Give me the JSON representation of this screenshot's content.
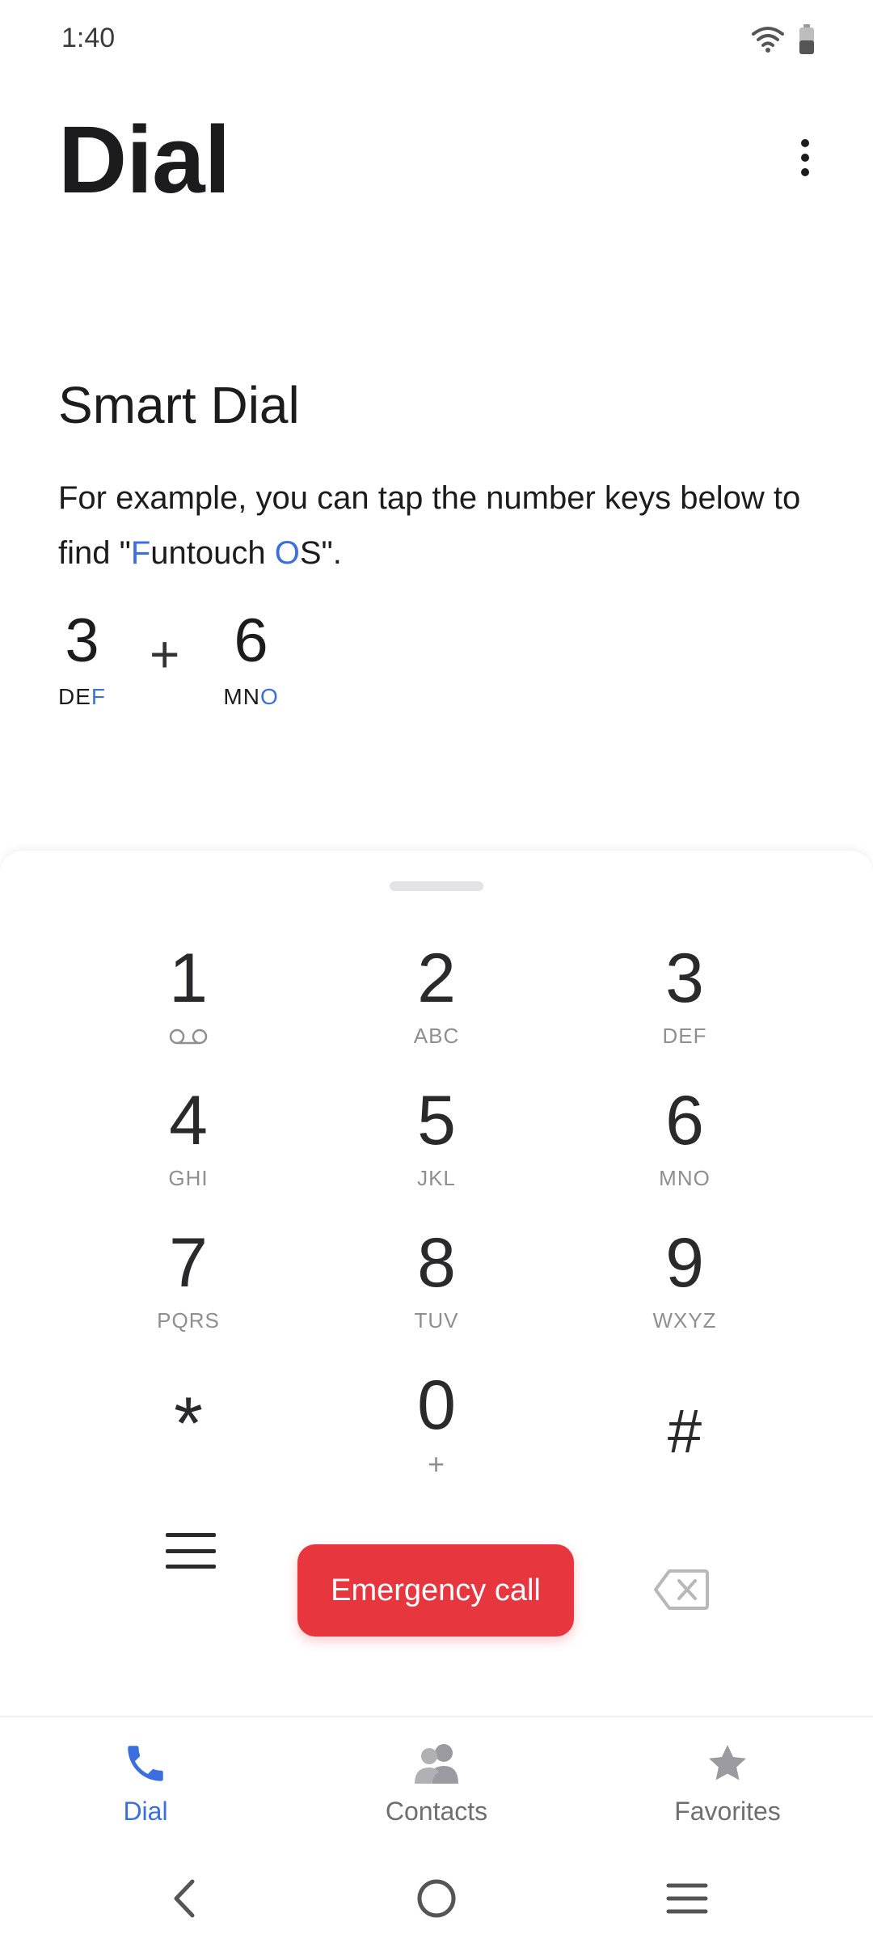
{
  "status_bar": {
    "time": "1:40"
  },
  "header": {
    "title": "Dial"
  },
  "tip": {
    "title": "Smart Dial",
    "text_before": "For example, you can tap the number keys below to find \"",
    "hl1": "F",
    "mid": "untouch ",
    "hl2": "O",
    "text_after": "S\".",
    "example": [
      {
        "digit": "3",
        "letters_plain": "DE",
        "letters_hl": "F"
      },
      {
        "digit": "6",
        "letters_plain": "MN",
        "letters_hl": "O"
      }
    ],
    "plus": "+"
  },
  "keypad": {
    "keys": [
      {
        "digit": "1",
        "letters": ""
      },
      {
        "digit": "2",
        "letters": "ABC"
      },
      {
        "digit": "3",
        "letters": "DEF"
      },
      {
        "digit": "4",
        "letters": "GHI"
      },
      {
        "digit": "5",
        "letters": "JKL"
      },
      {
        "digit": "6",
        "letters": "MNO"
      },
      {
        "digit": "7",
        "letters": "PQRS"
      },
      {
        "digit": "8",
        "letters": "TUV"
      },
      {
        "digit": "9",
        "letters": "WXYZ"
      },
      {
        "digit": "*",
        "letters": ""
      },
      {
        "digit": "0",
        "letters": "+"
      },
      {
        "digit": "#",
        "letters": ""
      }
    ],
    "emergency_label": "Emergency call"
  },
  "nav": {
    "dial": "Dial",
    "contacts": "Contacts",
    "favorites": "Favorites"
  },
  "colors": {
    "accent": "#3b6fe0",
    "emergency": "#e8363f"
  }
}
